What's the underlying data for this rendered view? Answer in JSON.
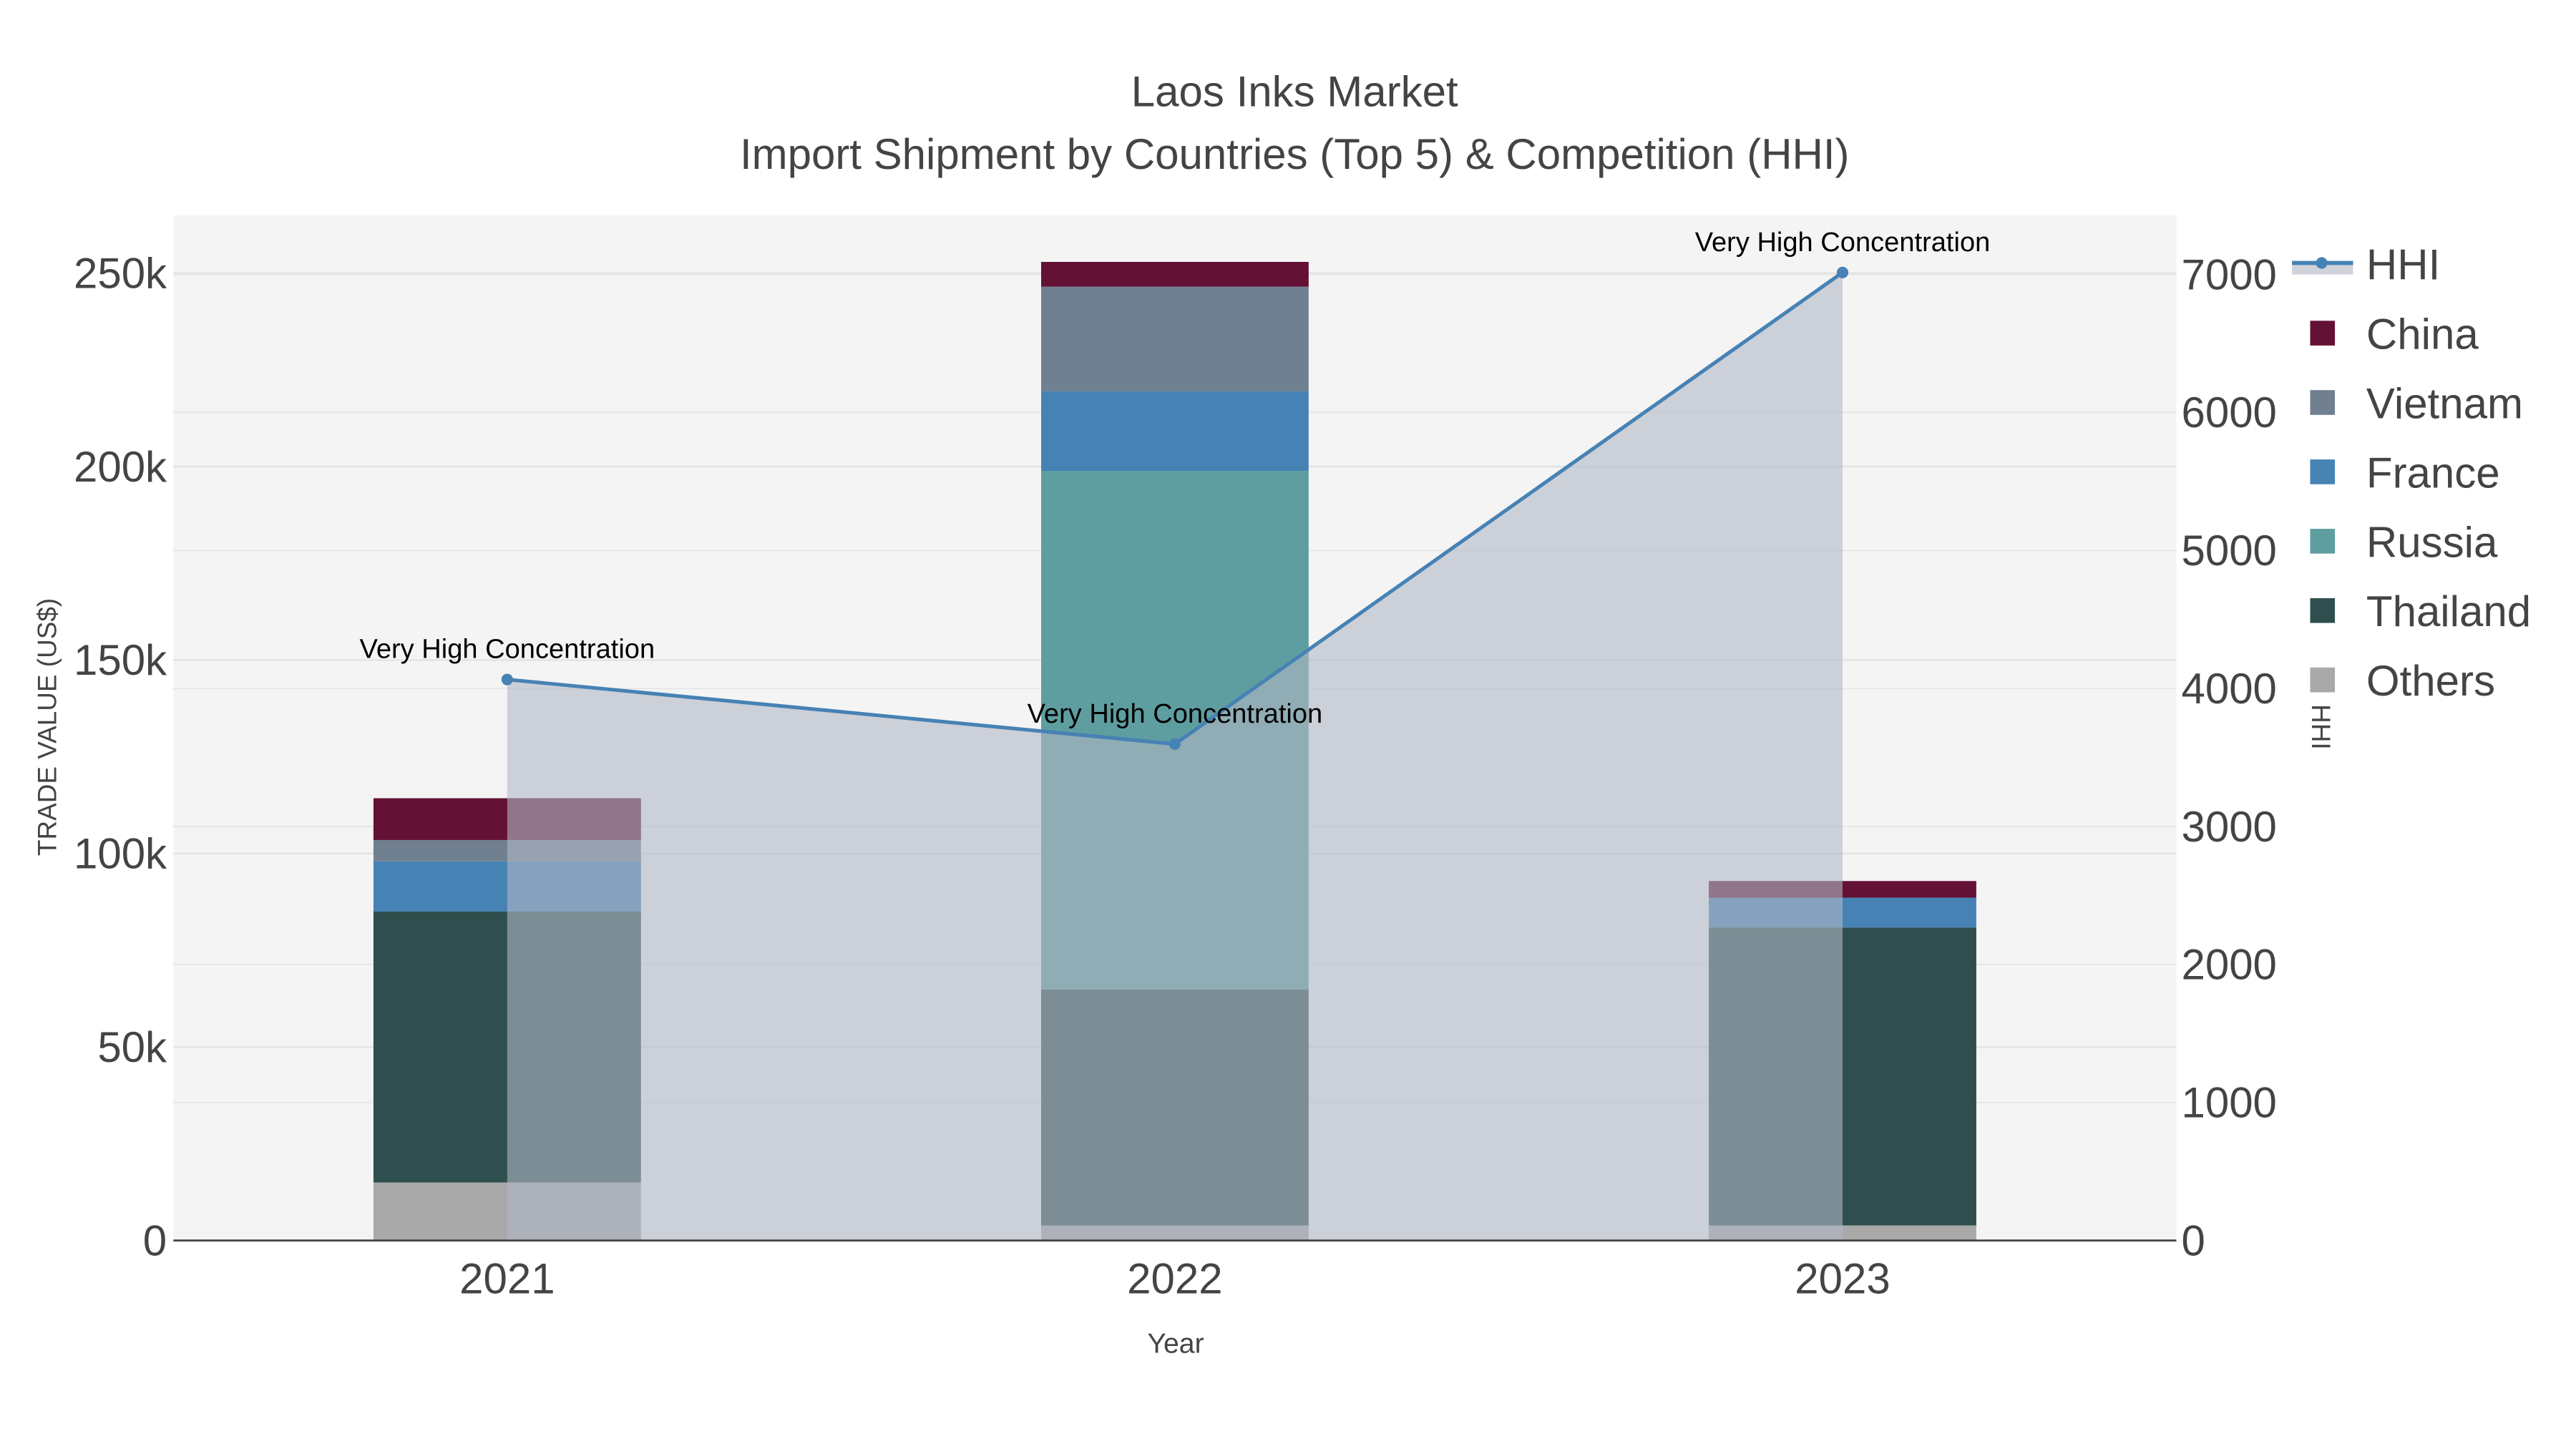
{
  "chart_data": {
    "type": "bar",
    "title": "Laos Inks Market",
    "subtitle": "Import Shipment by Countries (Top 5) & Competition (HHI)",
    "xlabel": "Year",
    "ylabel": "TRADE VALUE (US$)",
    "y2label": "HHI",
    "categories": [
      "2021",
      "2022",
      "2023"
    ],
    "ylim": [
      0,
      265000
    ],
    "y2lim": [
      0,
      7430
    ],
    "yticks": [
      0,
      50000,
      100000,
      150000,
      200000,
      250000
    ],
    "ytick_labels": [
      "0",
      "50k",
      "100k",
      "150k",
      "200k",
      "250k"
    ],
    "y2ticks": [
      0,
      1000,
      2000,
      3000,
      4000,
      5000,
      6000,
      7000
    ],
    "y2tick_labels": [
      "0",
      "1000",
      "2000",
      "3000",
      "4000",
      "5000",
      "6000",
      "7000"
    ],
    "stack_order": [
      "Others",
      "Thailand",
      "Russia",
      "France",
      "Vietnam",
      "China"
    ],
    "series": [
      {
        "name": "China",
        "color": "#631235",
        "values": [
          10800,
          6400,
          4300
        ]
      },
      {
        "name": "Vietnam",
        "color": "#708090",
        "values": [
          5500,
          27000,
          0
        ]
      },
      {
        "name": "France",
        "color": "#4682b4",
        "values": [
          13000,
          20600,
          7700
        ]
      },
      {
        "name": "Russia",
        "color": "#5f9ea0",
        "values": [
          0,
          134000,
          0
        ]
      },
      {
        "name": "Thailand",
        "color": "#2f4f4f",
        "values": [
          70000,
          61000,
          77000
        ]
      },
      {
        "name": "Others",
        "color": "#a9a9a9",
        "values": [
          15000,
          3900,
          3900
        ]
      }
    ],
    "line": {
      "name": "HHI",
      "color": "#4682b4",
      "fill": "#b0b8c4",
      "values": [
        4065,
        3597,
        7014
      ],
      "annotations": [
        "Very High Concentration",
        "Very High Concentration",
        "Very High Concentration"
      ]
    },
    "legend": {
      "placement": "right",
      "items": [
        "HHI",
        "China",
        "Vietnam",
        "France",
        "Russia",
        "Thailand",
        "Others"
      ]
    },
    "grid": true
  }
}
